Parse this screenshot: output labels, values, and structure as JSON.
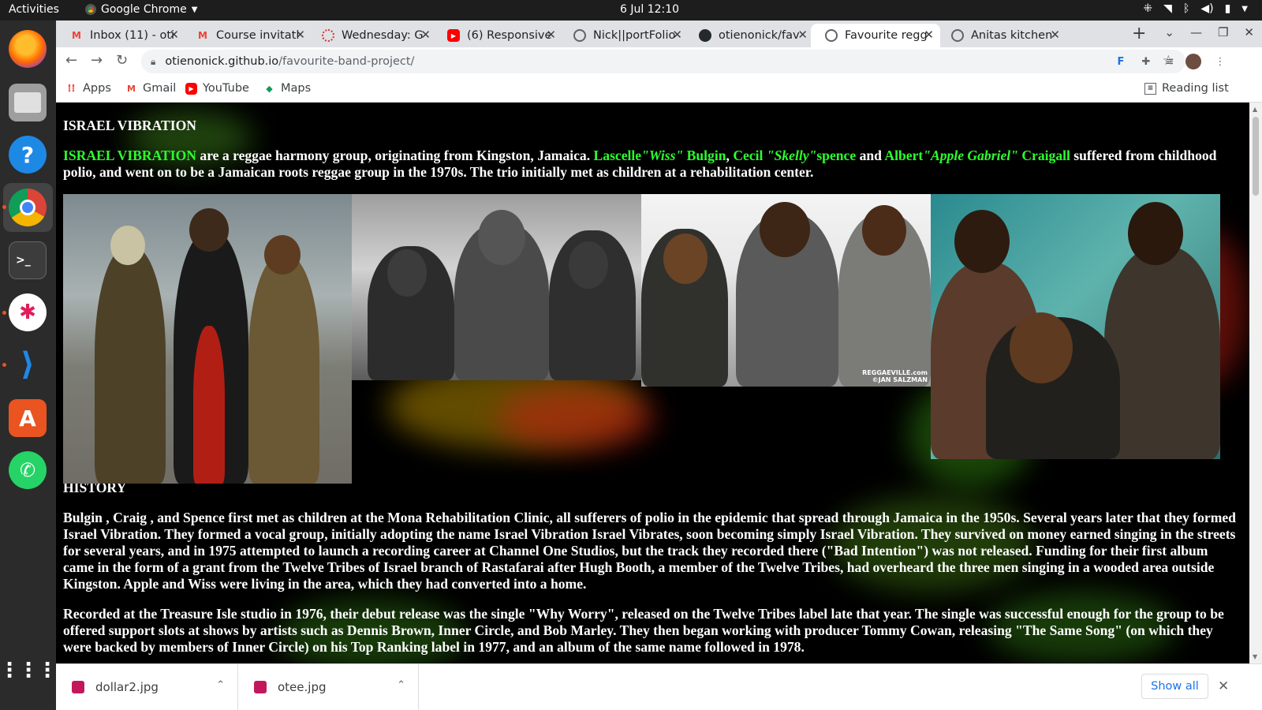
{
  "topbar": {
    "activities": "Activities",
    "app_name": "Google Chrome",
    "clock": "6 Jul  12:10"
  },
  "tabs": [
    {
      "label": "Inbox (11) - oti",
      "icon": "gmail-icon"
    },
    {
      "label": "Course invitati",
      "icon": "gmail-icon"
    },
    {
      "label": "Wednesday: G",
      "icon": "loading-icon"
    },
    {
      "label": "(6) Responsive",
      "icon": "youtube-icon"
    },
    {
      "label": "Nick||portFolio",
      "icon": "globe-icon"
    },
    {
      "label": "otienonick/fav",
      "icon": "github-icon"
    },
    {
      "label": "Favourite regg",
      "icon": "globe-icon"
    },
    {
      "label": "Anitas kitchen",
      "icon": "globe-icon"
    }
  ],
  "address_bar": {
    "host": "otienonick.github.io",
    "path": "/favourite-band-project/"
  },
  "bookmarks": {
    "apps": "Apps",
    "gmail": "Gmail",
    "youtube": "YouTube",
    "maps": "Maps",
    "reading_list": "Reading list"
  },
  "page": {
    "title": "ISRAEL VIBRATION",
    "intro": {
      "band": "ISRAEL VIBRATION",
      "t1": " are a reggae harmony group, originating from Kingston, Jamaica. ",
      "m1a": "Lascelle",
      "m1b": "\"Wiss\"",
      "m1c": " Bulgin",
      "comma": ", ",
      "m2a": "Cecil ",
      "m2b": "\"Skelly\"",
      "m2c": "spence",
      "and": " and ",
      "m3a": "Albert",
      "m3b": "\"Apple Gabriel\"",
      "m3c": " Craigall",
      "t2": " suffered from childhood polio, and went on to be a Jamaican roots reggae group in the 1970s. The trio initially met as children at a rehabilitation center."
    },
    "history_heading": "HISTORY",
    "history_p1": "Bulgin , Craig , and Spence first met as children at the Mona Rehabilitation Clinic, all sufferers of polio in the epidemic that spread through Jamaica in the 1950s. Several years later that they formed Israel Vibration. They formed a vocal group, initially adopting the name Israel Vibration Israel Vibrates, soon becoming simply Israel Vibration. They survived on money earned singing in the streets for several years, and in 1975 attempted to launch a recording career at Channel One Studios, but the track they recorded there (\"Bad Intention\") was not released. Funding for their first album came in the form of a grant from the Twelve Tribes of Israel branch of Rastafarai after Hugh Booth, a member of the Twelve Tribes, had overheard the three men singing in a wooded area outside Kingston. Apple and Wiss were living in the area, which they had converted into a home.",
    "history_p2": "Recorded at the Treasure Isle studio in 1976, their debut release was the single \"Why Worry\", released on the Twelve Tribes label late that year. The single was successful enough for the group to be offered support slots at shows by artists such as Dennis Brown, Inner Circle, and Bob Marley. They then began working with producer Tommy Cowan, releasing \"The Same Song\" (on which they were backed by members of Inner Circle) on his Top Ranking label in 1977, and an album of the same name followed in 1978.",
    "photo3_watermark": "REGGAEVILLE.com\n©JAN SALZMAN"
  },
  "downloads": [
    {
      "name": "dollar2.jpg"
    },
    {
      "name": "otee.jpg"
    }
  ],
  "download_shelf": {
    "show_all": "Show all"
  }
}
